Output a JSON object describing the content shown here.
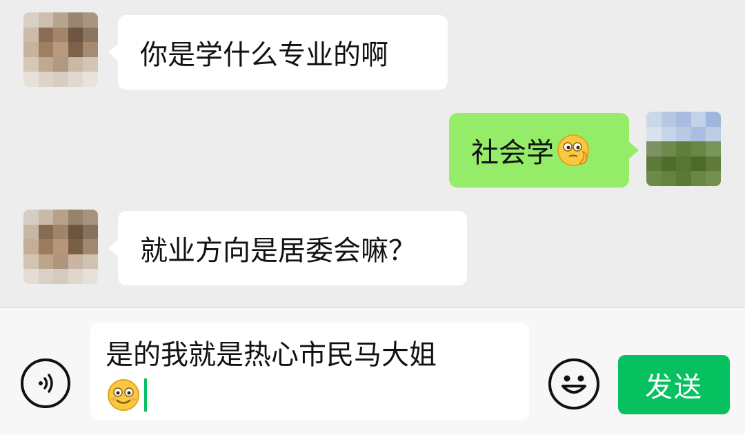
{
  "messages": [
    {
      "side": "left",
      "text": "你是学什么专业的啊"
    },
    {
      "side": "right",
      "text": "社会学",
      "emoji": "thinking-face-emoji"
    },
    {
      "side": "left",
      "text": "就业方向是居委会嘛？"
    }
  ],
  "input": {
    "value": "是的我就是热心市民马大姐",
    "trailing_emoji": "smiling-face-emoji"
  },
  "toolbar": {
    "voice_icon": "voice-icon",
    "emoji_icon": "emoji-face-icon",
    "send_label": "发送"
  },
  "colors": {
    "background": "#ededed",
    "bubble_incoming": "#ffffff",
    "bubble_outgoing": "#95ec69",
    "accent": "#07c160",
    "text": "#111111"
  }
}
